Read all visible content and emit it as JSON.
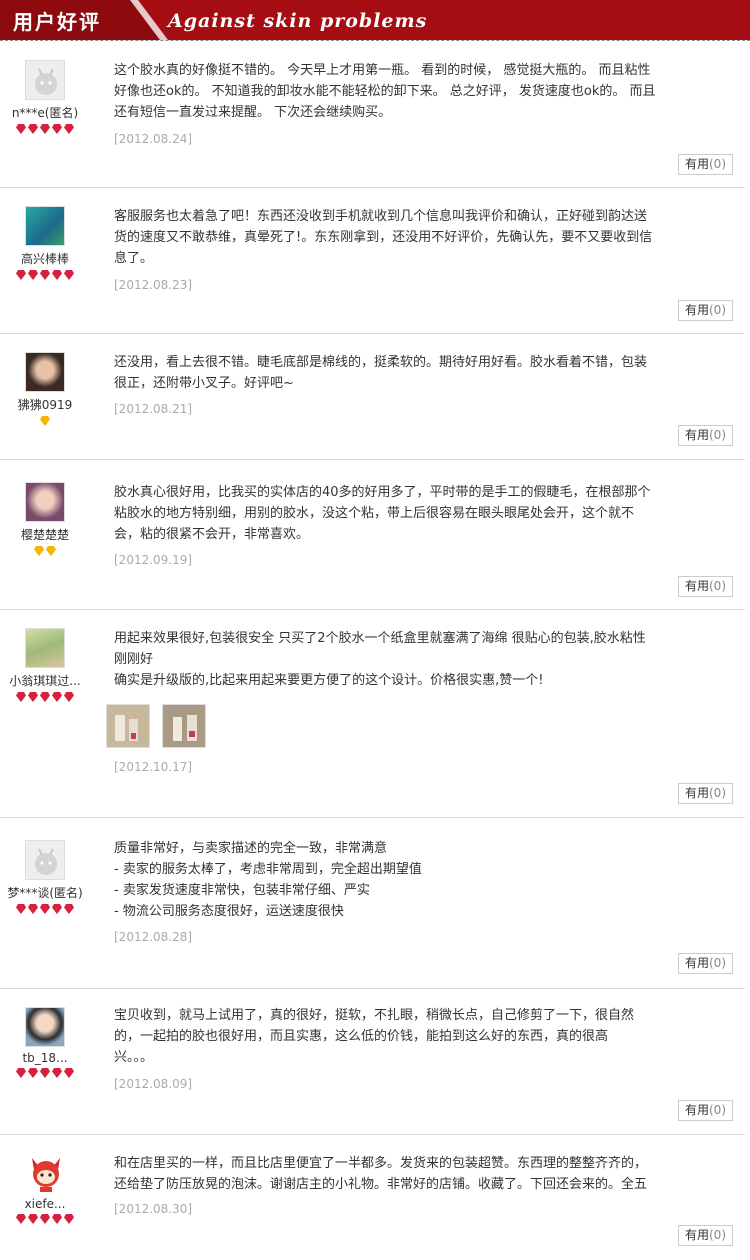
{
  "header": {
    "title": "用户好评",
    "slogan": "Against skin problems"
  },
  "useful_label": "有用",
  "reviews": [
    {
      "user": "n***e(匿名)",
      "avatar": "default-avatar",
      "stars": {
        "count": 5,
        "color": "red"
      },
      "lines": [
        "这个胶水真的好像挺不错的。 今天早上才用第一瓶。 看到的时候， 感觉挺大瓶的。 而且粘性",
        "好像也还ok的。 不知道我的卸妆水能不能轻松的卸下来。 总之好评， 发货速度也ok的。 而且",
        "还有短信一直发过来提醒。 下次还会继续购买。"
      ],
      "date": "[2012.08.24]",
      "useful_count": "(0)"
    },
    {
      "user": "高兴棒棒",
      "avatar": "photo-avatar",
      "stars": {
        "count": 5,
        "color": "red"
      },
      "lines": [
        "客服服务也太着急了吧！东西还没收到手机就收到几个信息叫我评价和确认，正好碰到韵达送",
        "货的速度又不敢恭维，真晕死了!。东东刚拿到，还没用不好评价，先确认先，要不又要收到信",
        "息了。"
      ],
      "date": "[2012.08.23]",
      "useful_count": "(0)"
    },
    {
      "user": "狒狒0919",
      "avatar": "photo-avatar",
      "stars": {
        "count": 1,
        "color": "yellow"
      },
      "lines": [
        "还没用，看上去很不错。睫毛底部是棉线的，挺柔软的。期待好用好看。胶水看着不错，包装",
        "很正，还附带小叉子。好评吧~"
      ],
      "date": "[2012.08.21]",
      "useful_count": "(0)"
    },
    {
      "user": "樱楚楚楚",
      "avatar": "photo-avatar",
      "stars": {
        "count": 2,
        "color": "yellow"
      },
      "lines": [
        "胶水真心很好用，比我买的实体店的40多的好用多了，平时带的是手工的假睫毛，在根部那个",
        "粘胶水的地方特别细，用别的胶水，没这个粘，带上后很容易在眼头眼尾处会开，这个就不",
        "会，粘的很紧不会开，非常喜欢。"
      ],
      "date": "[2012.09.19]",
      "useful_count": "(0)"
    },
    {
      "user": "小翁琪琪过...",
      "avatar": "photo-avatar",
      "stars": {
        "count": 5,
        "color": "red"
      },
      "lines": [
        "用起来效果很好,包装很安全 只买了2个胶水一个纸盒里就塞满了海绵 很贴心的包装,胶水粘性",
        "刚刚好",
        "确实是升级版的,比起来用起来要更方便了的这个设计。价格很实惠,赞一个!"
      ],
      "date": "[2012.10.17]",
      "useful_count": "(0)"
    },
    {
      "user": "梦***谈(匿名)",
      "avatar": "default-avatar",
      "stars": {
        "count": 5,
        "color": "red"
      },
      "lines": [
        "质量非常好，与卖家描述的完全一致，非常满意",
        "- 卖家的服务太棒了，考虑非常周到，完全超出期望值",
        "- 卖家发货速度非常快，包装非常仔细、严实",
        "- 物流公司服务态度很好，运送速度很快"
      ],
      "date": "[2012.08.28]",
      "useful_count": "(0)"
    },
    {
      "user": "tb_18...",
      "avatar": "photo-avatar",
      "stars": {
        "count": 5,
        "color": "red"
      },
      "lines": [
        "宝贝收到，就马上试用了，真的很好，挺软，不扎眼，稍微长点，自己修剪了一下，很自然",
        "的，一起拍的胶也很好用，而且实惠，这么低的价钱，能拍到这么好的东西，真的很高",
        "兴。。。"
      ],
      "date": "[2012.08.09]",
      "useful_count": "(0)"
    },
    {
      "user": "xiefe...",
      "avatar": "cartoon-avatar",
      "stars": {
        "count": 5,
        "color": "red"
      },
      "lines": [
        "和在店里买的一样，而且比店里便宜了一半都多。发货来的包装超赞。东西理的整整齐齐的，",
        "还给垫了防压放晃的泡沫。谢谢店主的小礼物。非常好的店铺。收藏了。下回还会来的。全五"
      ],
      "date": "[2012.08.30]",
      "useful_count": "(0)"
    }
  ]
}
